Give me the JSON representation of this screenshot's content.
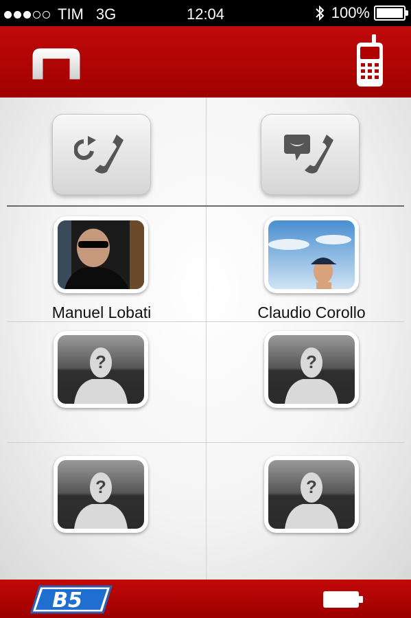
{
  "status_bar": {
    "carrier": "TIM",
    "network": "3G",
    "time": "12:04",
    "battery_percent": "100%",
    "signal_bars_filled": 3,
    "signal_bars_total": 5
  },
  "header": {
    "logo_icon": "n-logo-icon",
    "phone_icon": "mobile-phone-icon"
  },
  "actions": {
    "left_icon": "call-back-icon",
    "right_icon": "call-message-icon"
  },
  "contacts": [
    {
      "name": "Manuel Lobati",
      "has_photo": true
    },
    {
      "name": "Claudio Corollo",
      "has_photo": true
    },
    {
      "name": "",
      "has_photo": false
    },
    {
      "name": "",
      "has_photo": false
    },
    {
      "name": "",
      "has_photo": false
    },
    {
      "name": "",
      "has_photo": false
    }
  ],
  "footer": {
    "brand_text": "B5",
    "battery_icon": "battery-icon"
  },
  "colors": {
    "brand_red": "#b00000",
    "background": "#f2f2f2"
  }
}
